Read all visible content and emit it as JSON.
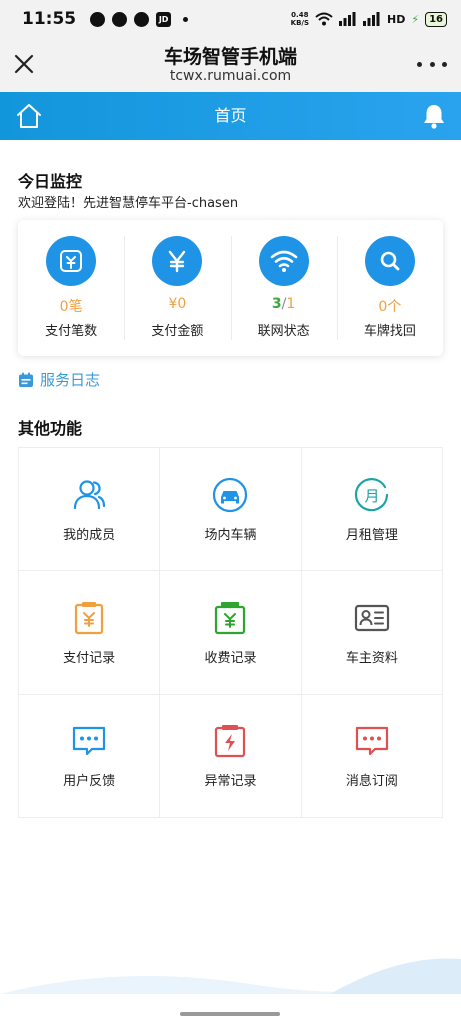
{
  "status_bar": {
    "time": "11:55",
    "speed_top": "0.48",
    "speed_bottom": "KB/S",
    "network": "HD",
    "battery": "16"
  },
  "browser": {
    "title": "车场智管手机端",
    "url": "tcwx.rumuai.com"
  },
  "header": {
    "title": "首页"
  },
  "monitor": {
    "title": "今日监控",
    "welcome": "欢迎登陆！先进智慧停车平台-chasen",
    "stats": [
      {
        "value": "0笔",
        "label": "支付笔数",
        "icon": "payment-icon",
        "color": "#f0a040"
      },
      {
        "value": "¥0",
        "label": "支付金额",
        "icon": "yen-icon",
        "color": "#f0a040"
      },
      {
        "value_a": "3",
        "value_sep": "/",
        "value_b": "1",
        "label": "联网状态",
        "icon": "wifi-icon",
        "color_a": "#3aa83a",
        "color_b": "#f0a040"
      },
      {
        "value": "0个",
        "label": "车牌找回",
        "icon": "search-icon",
        "color": "#f0a040"
      }
    ]
  },
  "service_log": {
    "label": "服务日志",
    "icon": "calendar-icon"
  },
  "other": {
    "title": "其他功能",
    "items": [
      {
        "label": "我的成员",
        "icon": "members-icon"
      },
      {
        "label": "场内车辆",
        "icon": "car-icon"
      },
      {
        "label": "月租管理",
        "icon": "monthly-icon"
      },
      {
        "label": "支付记录",
        "icon": "payment-record-icon"
      },
      {
        "label": "收费记录",
        "icon": "charge-record-icon"
      },
      {
        "label": "车主资料",
        "icon": "owner-card-icon"
      },
      {
        "label": "用户反馈",
        "icon": "feedback-icon"
      },
      {
        "label": "异常记录",
        "icon": "exception-icon"
      },
      {
        "label": "消息订阅",
        "icon": "message-icon"
      }
    ]
  },
  "colors": {
    "accent": "#1296db",
    "orange": "#f0a040",
    "green": "#3aa83a",
    "red": "#e05050"
  }
}
